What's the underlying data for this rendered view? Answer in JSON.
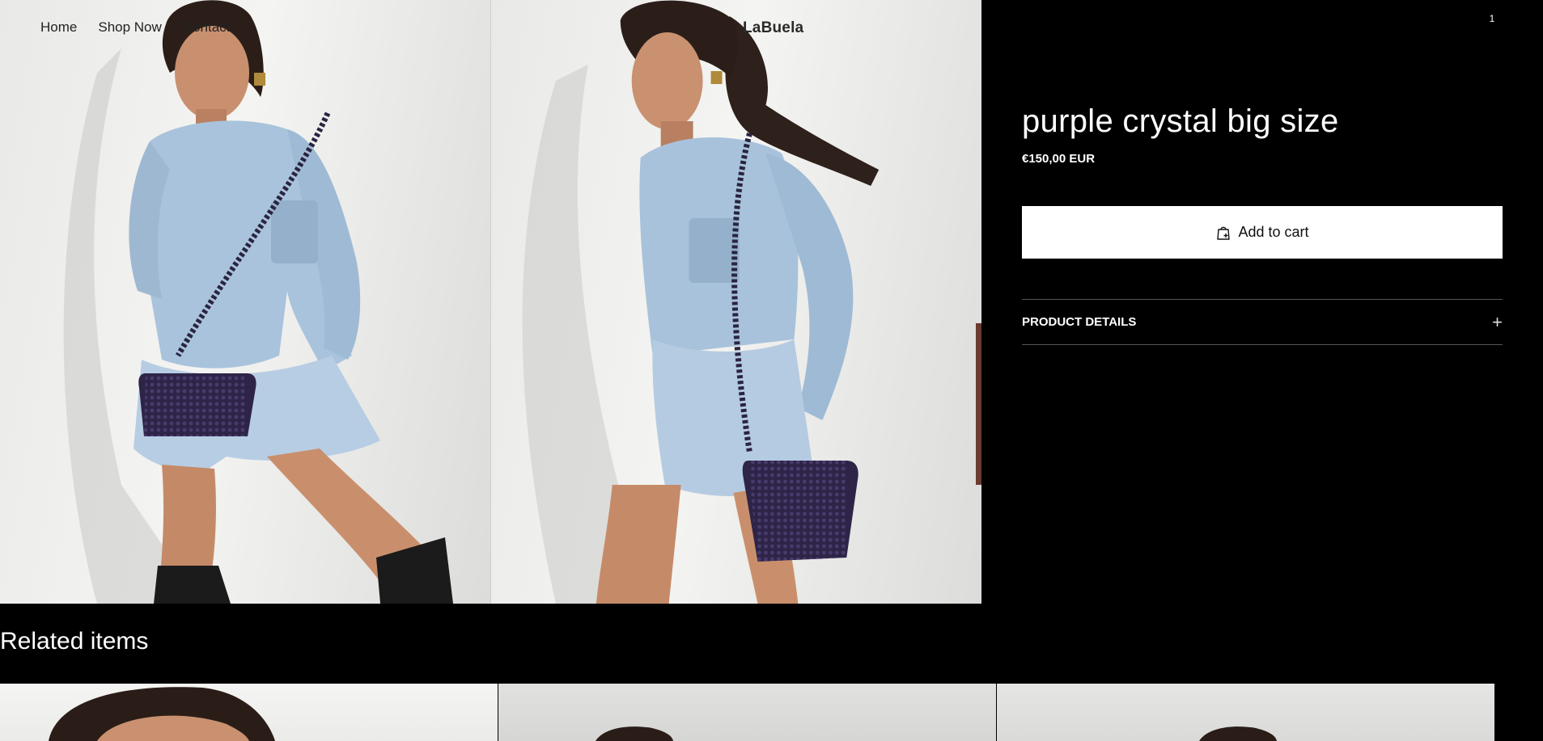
{
  "nav": {
    "links": [
      "Home",
      "Shop Now",
      "Contact"
    ],
    "brand": "LaBuela",
    "cart_count": "1"
  },
  "product": {
    "title": "purple crystal big size",
    "price": "€150,00 EUR",
    "add_to_cart_label": "Add to cart",
    "details_label": "PRODUCT DETAILS",
    "details_toggle": "+"
  },
  "gallery": {
    "images": [
      "model-photo-front",
      "model-photo-side"
    ]
  },
  "related": {
    "title": "Related items"
  },
  "colors": {
    "background": "#000000",
    "button_bg": "#ffffff",
    "button_text": "#111111",
    "divider": "#555555"
  }
}
